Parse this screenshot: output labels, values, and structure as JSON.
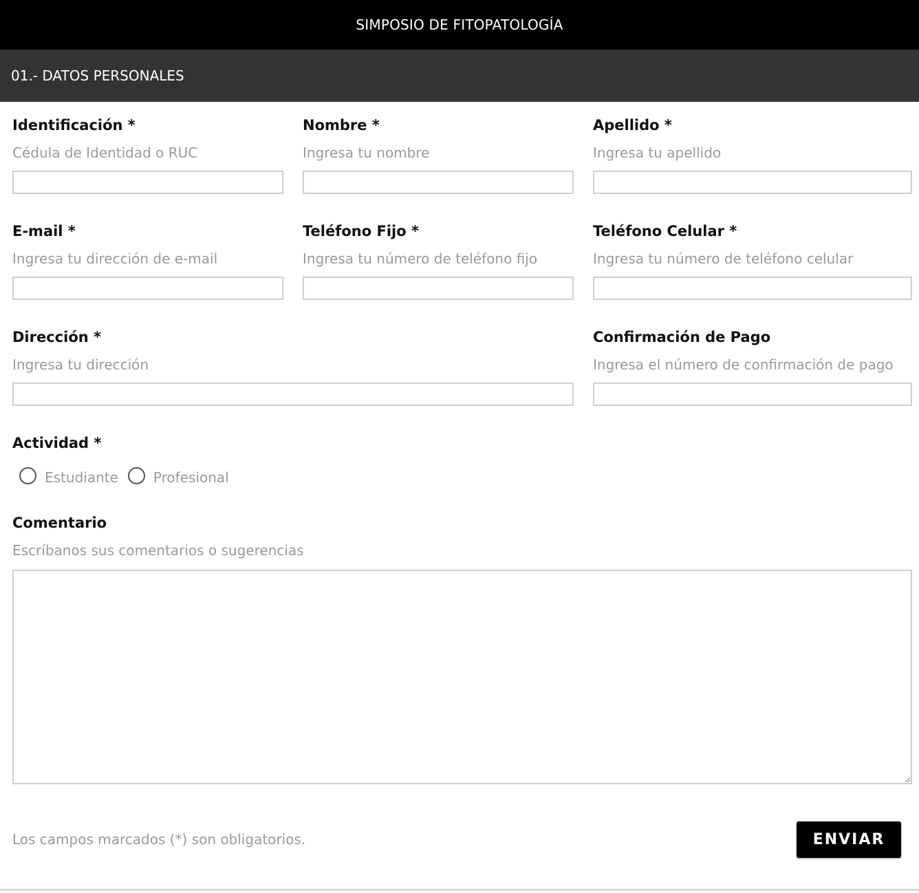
{
  "header": {
    "title": "SIMPOSIO DE FITOPATOLOGÍA"
  },
  "section": {
    "title": "01.- DATOS PERSONALES"
  },
  "fields": {
    "identificacion": {
      "label": "Identificación *",
      "hint": "Cédula de Identidad o RUC",
      "value": ""
    },
    "nombre": {
      "label": "Nombre *",
      "hint": "Ingresa tu nombre",
      "value": ""
    },
    "apellido": {
      "label": "Apellido *",
      "hint": "Ingresa tu apellido",
      "value": ""
    },
    "email": {
      "label": "E-mail *",
      "hint": "Ingresa tu dirección de e-mail",
      "value": ""
    },
    "telefono_fijo": {
      "label": "Teléfono Fijo *",
      "hint": "Ingresa tu número de teléfono fijo",
      "value": ""
    },
    "telefono_celular": {
      "label": "Teléfono Celular *",
      "hint": "Ingresa tu número de teléfono celular",
      "value": ""
    },
    "direccion": {
      "label": "Dirección *",
      "hint": "Ingresa tu dirección",
      "value": ""
    },
    "confirmacion_pago": {
      "label": "Confirmación de Pago",
      "hint": "Ingresa el número de confirmación de pago",
      "value": ""
    }
  },
  "actividad": {
    "label": "Actividad *",
    "options": [
      {
        "label": "Estudiante",
        "checked": false
      },
      {
        "label": "Profesional",
        "checked": false
      }
    ]
  },
  "comentario": {
    "label": "Comentario",
    "hint": "Escríbanos sus comentarios o sugerencias",
    "value": ""
  },
  "footer": {
    "note": "Los campos marcados (*) son obligatorios.",
    "submit_label": "ENVIAR"
  },
  "colors": {
    "header_bg": "#000000",
    "section_bg": "#333333",
    "hint_text": "#9a9a9a",
    "input_border": "#cfcfcf"
  }
}
